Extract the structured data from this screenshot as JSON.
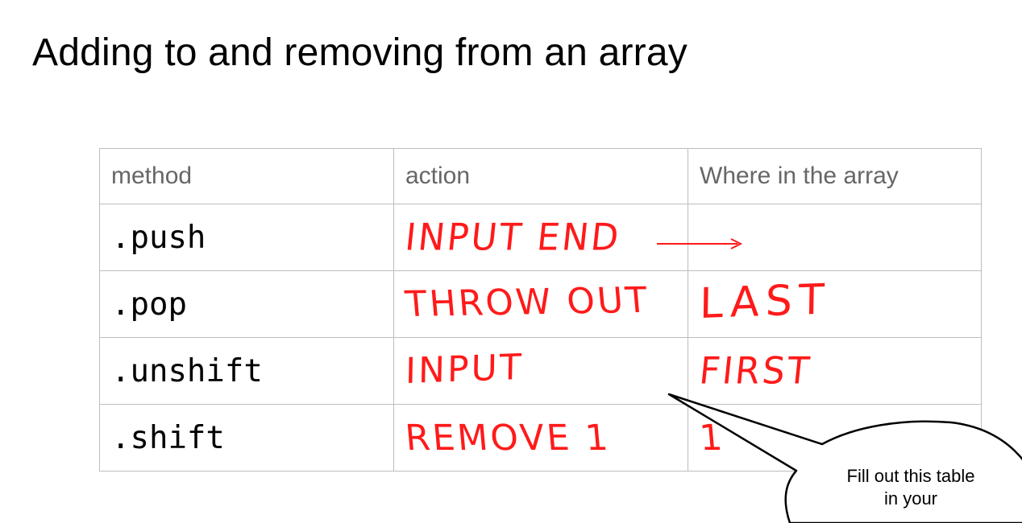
{
  "slide": {
    "title": "Adding to and removing from an array"
  },
  "table": {
    "headers": [
      "method",
      "action",
      "Where in the array"
    ],
    "rows": [
      {
        "method": ".push",
        "action": "INPUT END",
        "where": ""
      },
      {
        "method": ".pop",
        "action": "THROW OUT",
        "where": "LAST"
      },
      {
        "method": ".unshift",
        "action": "INPUT",
        "where": "FIRST"
      },
      {
        "method": ".shift",
        "action": "REMOVE 1",
        "where": "1"
      }
    ]
  },
  "callout": {
    "text": "Fill out this table in your"
  },
  "colors": {
    "ink": "#ff1a1a",
    "header_text": "#666666",
    "grid": "#bdbdbd"
  }
}
